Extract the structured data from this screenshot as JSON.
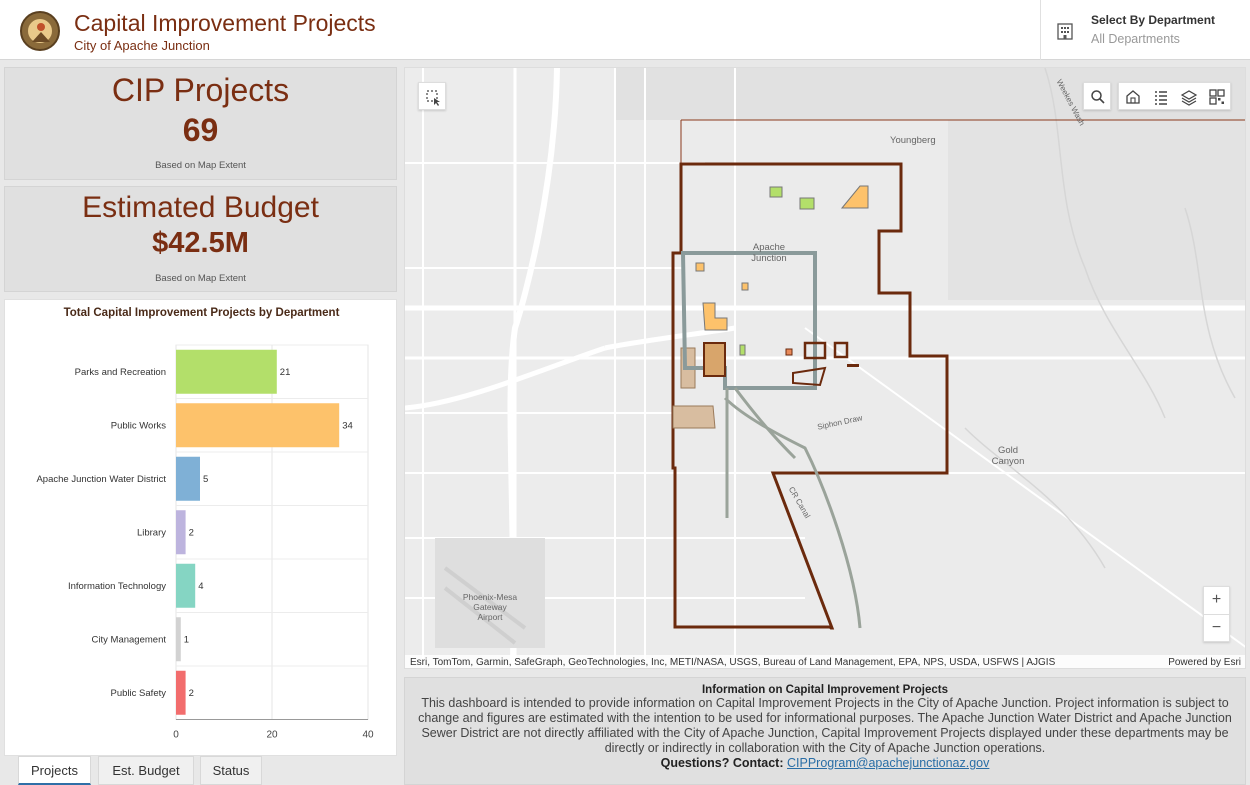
{
  "header": {
    "title": "Capital Improvement Projects",
    "subtitle": "City of Apache Junction",
    "dept_label": "Select By Department",
    "dept_value": "All Departments",
    "dept_icon": "building-icon"
  },
  "cards": {
    "cip": {
      "title": "CIP Projects",
      "value": "69",
      "note": "Based on Map Extent"
    },
    "budget": {
      "title": "Estimated Budget",
      "value": "$42.5M",
      "note": "Based on Map Extent"
    }
  },
  "chart_data": {
    "type": "bar",
    "orientation": "horizontal",
    "title": "Total Capital Improvement Projects by Department",
    "categories": [
      "Parks and Recreation",
      "Public Works",
      "Apache Junction Water District",
      "Library",
      "Information Technology",
      "City Management",
      "Public Safety"
    ],
    "values": [
      21,
      34,
      5,
      2,
      4,
      1,
      2
    ],
    "colors": [
      "#b3df6a",
      "#fdc26b",
      "#7fb0d6",
      "#bdb4de",
      "#85d5c3",
      "#d2d2d2",
      "#f26d6d"
    ],
    "xlim": [
      0,
      40
    ],
    "xticks": [
      0,
      20,
      40
    ],
    "grid": true
  },
  "tabs": [
    {
      "label": "Projects",
      "active": true
    },
    {
      "label": "Est. Budget",
      "active": false
    },
    {
      "label": "Status",
      "active": false
    }
  ],
  "map": {
    "labels": {
      "youngberg": "Youngberg",
      "apache": "Apache Junction",
      "gold": "Gold Canyon",
      "airport": "Phoenix-Mesa Gateway Airport",
      "siphon": "Siphon Draw",
      "wash": "Weekes Wash",
      "cr": "CR Canal"
    },
    "attribution": "Esri, TomTom, Garmin, SafeGraph, GeoTechnologies, Inc, METI/NASA, USGS, Bureau of Land Management, EPA, NPS, USDA, USFWS | AJGIS",
    "powered": "Powered by Esri",
    "zoom_in": "+",
    "zoom_out": "−"
  },
  "info": {
    "title": "Information on Capital Improvement Projects",
    "body": "This dashboard is intended to provide information on Capital Improvement Projects in the City of Apache Junction.  Project information is subject to change and figures are estimated with the intention to be used for informational purposes.  The Apache Junction Water District and Apache Junction Sewer District are not directly affiliated with the City of Apache Junction, Capital Improvement Projects displayed under these departments may be directly or indirectly in collaboration with the City of Apache Junction operations.",
    "contact_label": "Questions? Contact:",
    "contact_email": "CIPProgram@apachejunctionaz.gov"
  }
}
